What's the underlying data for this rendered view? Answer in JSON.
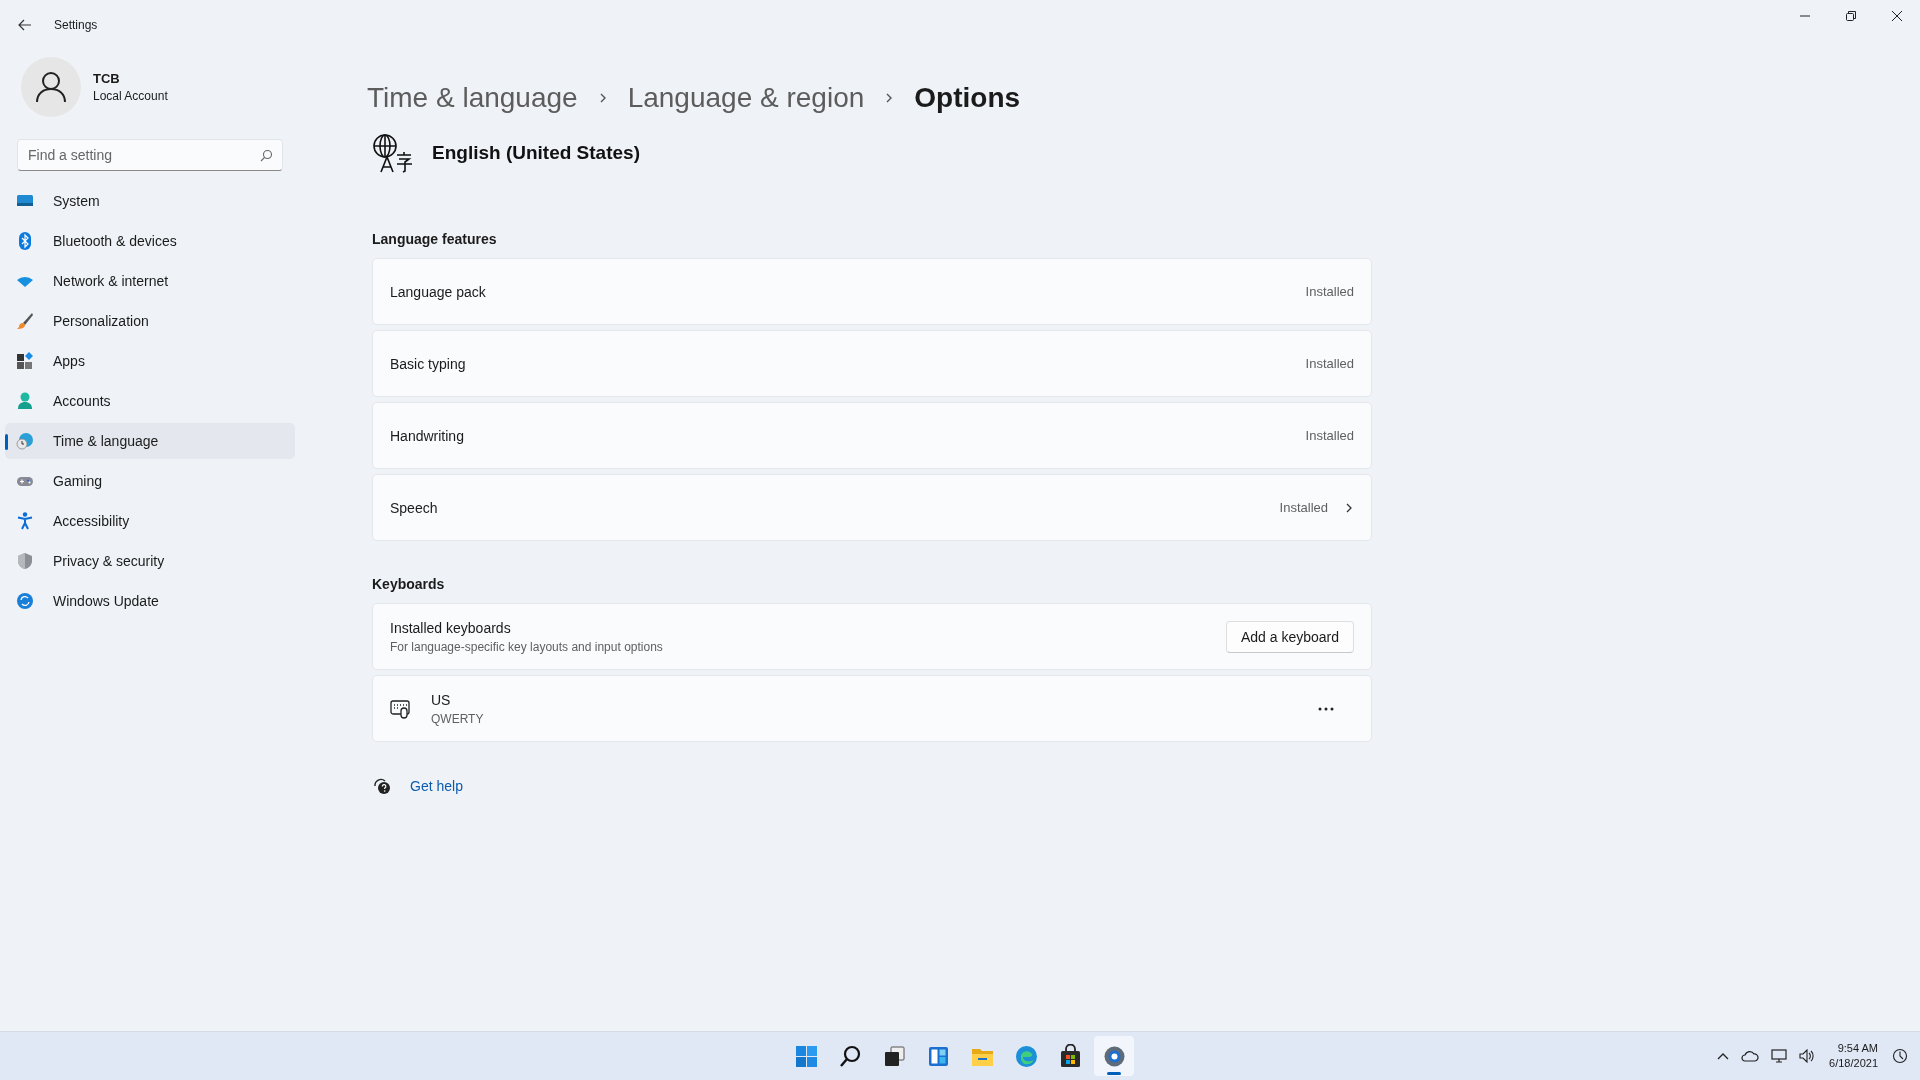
{
  "window": {
    "title": "Settings"
  },
  "account": {
    "name": "TCB",
    "type": "Local Account"
  },
  "search": {
    "placeholder": "Find a setting"
  },
  "sidebar": {
    "items": [
      {
        "label": "System",
        "selected": false
      },
      {
        "label": "Bluetooth & devices",
        "selected": false
      },
      {
        "label": "Network & internet",
        "selected": false
      },
      {
        "label": "Personalization",
        "selected": false
      },
      {
        "label": "Apps",
        "selected": false
      },
      {
        "label": "Accounts",
        "selected": false
      },
      {
        "label": "Time & language",
        "selected": true
      },
      {
        "label": "Gaming",
        "selected": false
      },
      {
        "label": "Accessibility",
        "selected": false
      },
      {
        "label": "Privacy & security",
        "selected": false
      },
      {
        "label": "Windows Update",
        "selected": false
      }
    ]
  },
  "breadcrumb": [
    "Time & language",
    "Language & region",
    "Options"
  ],
  "language": {
    "name": "English (United States)"
  },
  "sections": [
    {
      "title": "Language features",
      "rows": [
        {
          "kind": "status",
          "label": "Language pack",
          "status": "Installed",
          "expandable": false
        },
        {
          "kind": "status",
          "label": "Basic typing",
          "status": "Installed",
          "expandable": false
        },
        {
          "kind": "status",
          "label": "Handwriting",
          "status": "Installed",
          "expandable": false
        },
        {
          "kind": "status",
          "label": "Speech",
          "status": "Installed",
          "expandable": true
        }
      ]
    },
    {
      "title": "Keyboards",
      "rows": [
        {
          "kind": "action",
          "label": "Installed keyboards",
          "description": "For language-specific key layouts and input options",
          "button": "Add a keyboard"
        },
        {
          "kind": "keyboard",
          "label": "US",
          "description": "QWERTY"
        }
      ]
    }
  ],
  "help": {
    "label": "Get help"
  },
  "taskbar": {
    "apps": [
      {
        "selected": false
      },
      {
        "selected": false
      },
      {
        "selected": false
      },
      {
        "selected": false
      },
      {
        "selected": false
      },
      {
        "selected": false
      },
      {
        "selected": false
      },
      {
        "selected": true
      }
    ],
    "clock": {
      "time": "9:54 AM",
      "date": "6/18/2021"
    }
  }
}
